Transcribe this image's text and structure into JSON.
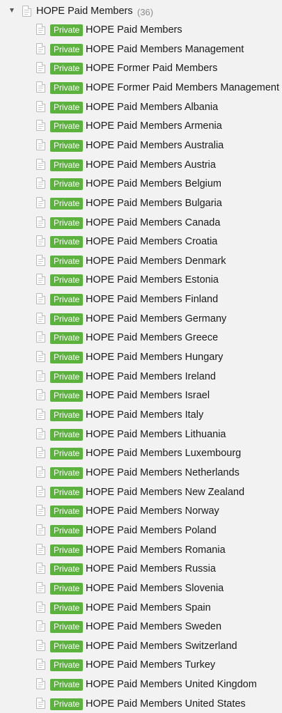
{
  "tree": {
    "root": {
      "label": "HOPE Paid Members",
      "count": "(36)",
      "icon": "document-icon",
      "expanded": true
    },
    "badge_color": "#5bb33e",
    "items": [
      {
        "badge": "Private",
        "label": "HOPE Paid Members"
      },
      {
        "badge": "Private",
        "label": "HOPE Paid Members Management"
      },
      {
        "badge": "Private",
        "label": "HOPE Former Paid Members"
      },
      {
        "badge": "Private",
        "label": "HOPE Former Paid Members Management"
      },
      {
        "badge": "Private",
        "label": "HOPE Paid Members Albania"
      },
      {
        "badge": "Private",
        "label": "HOPE Paid Members Armenia"
      },
      {
        "badge": "Private",
        "label": "HOPE Paid Members Australia"
      },
      {
        "badge": "Private",
        "label": "HOPE Paid Members Austria"
      },
      {
        "badge": "Private",
        "label": "HOPE Paid Members Belgium"
      },
      {
        "badge": "Private",
        "label": "HOPE Paid Members Bulgaria"
      },
      {
        "badge": "Private",
        "label": "HOPE Paid Members Canada"
      },
      {
        "badge": "Private",
        "label": "HOPE Paid Members Croatia"
      },
      {
        "badge": "Private",
        "label": "HOPE Paid Members Denmark"
      },
      {
        "badge": "Private",
        "label": "HOPE Paid Members Estonia"
      },
      {
        "badge": "Private",
        "label": "HOPE Paid Members Finland"
      },
      {
        "badge": "Private",
        "label": "HOPE Paid Members Germany"
      },
      {
        "badge": "Private",
        "label": "HOPE Paid Members Greece"
      },
      {
        "badge": "Private",
        "label": "HOPE Paid Members Hungary"
      },
      {
        "badge": "Private",
        "label": "HOPE Paid Members Ireland"
      },
      {
        "badge": "Private",
        "label": "HOPE Paid Members Israel"
      },
      {
        "badge": "Private",
        "label": "HOPE Paid Members Italy"
      },
      {
        "badge": "Private",
        "label": "HOPE Paid Members Lithuania"
      },
      {
        "badge": "Private",
        "label": "HOPE Paid Members Luxembourg"
      },
      {
        "badge": "Private",
        "label": "HOPE Paid Members Netherlands"
      },
      {
        "badge": "Private",
        "label": "HOPE Paid Members New Zealand"
      },
      {
        "badge": "Private",
        "label": "HOPE Paid Members Norway"
      },
      {
        "badge": "Private",
        "label": "HOPE Paid Members Poland"
      },
      {
        "badge": "Private",
        "label": "HOPE Paid Members Romania"
      },
      {
        "badge": "Private",
        "label": "HOPE Paid Members Russia"
      },
      {
        "badge": "Private",
        "label": "HOPE Paid Members Slovenia"
      },
      {
        "badge": "Private",
        "label": "HOPE Paid Members Spain"
      },
      {
        "badge": "Private",
        "label": "HOPE Paid Members Sweden"
      },
      {
        "badge": "Private",
        "label": "HOPE Paid Members Switzerland"
      },
      {
        "badge": "Private",
        "label": "HOPE Paid Members Turkey"
      },
      {
        "badge": "Private",
        "label": "HOPE Paid Members United Kingdom"
      },
      {
        "badge": "Private",
        "label": "HOPE Paid Members United States"
      }
    ]
  }
}
